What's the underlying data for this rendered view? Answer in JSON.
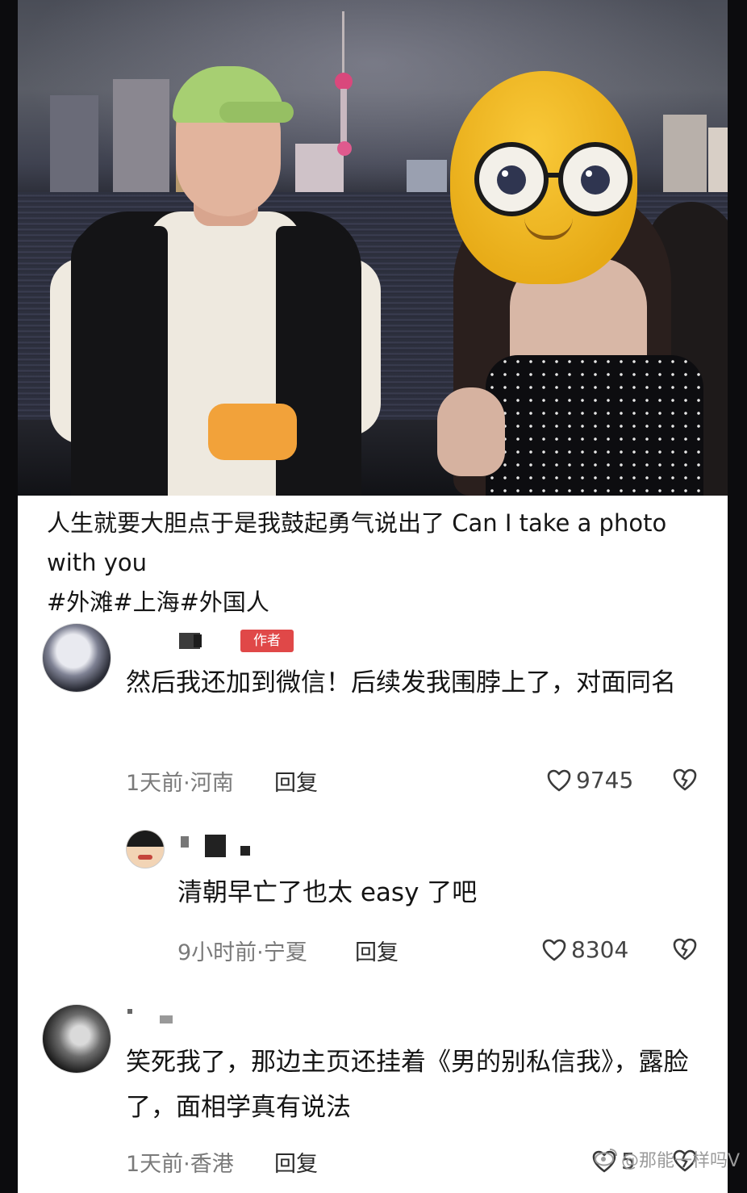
{
  "post": {
    "caption": "人生就要大胆点于是我鼓起勇气说出了 Can I take a photo with you",
    "hashtags": "#外滩#上海#外国人"
  },
  "comments": [
    {
      "author_badge": "作者",
      "text": "然后我还加到微信！后续发我围脖上了，对面同名",
      "meta": "1天前·河南",
      "reply_label": "回复",
      "likes": "9745"
    },
    {
      "text": "清朝早亡了也太 easy 了吧",
      "meta": "9小时前·宁夏",
      "reply_label": "回复",
      "likes": "8304"
    },
    {
      "text": "笑死我了，那边主页还挂着《男的别私信我》，露脸了，面相学真有说法",
      "meta": "1天前·香港",
      "reply_label": "回复",
      "likes": "5"
    }
  ],
  "icons": {
    "like": "heart-outline-icon",
    "dislike": "broken-heart-icon",
    "watermark": "weibo-icon"
  },
  "watermark": "@那能一样吗V",
  "colors": {
    "badge": "#e04848",
    "emoji": "#f2bd2a",
    "cap": "#a7cf72"
  }
}
